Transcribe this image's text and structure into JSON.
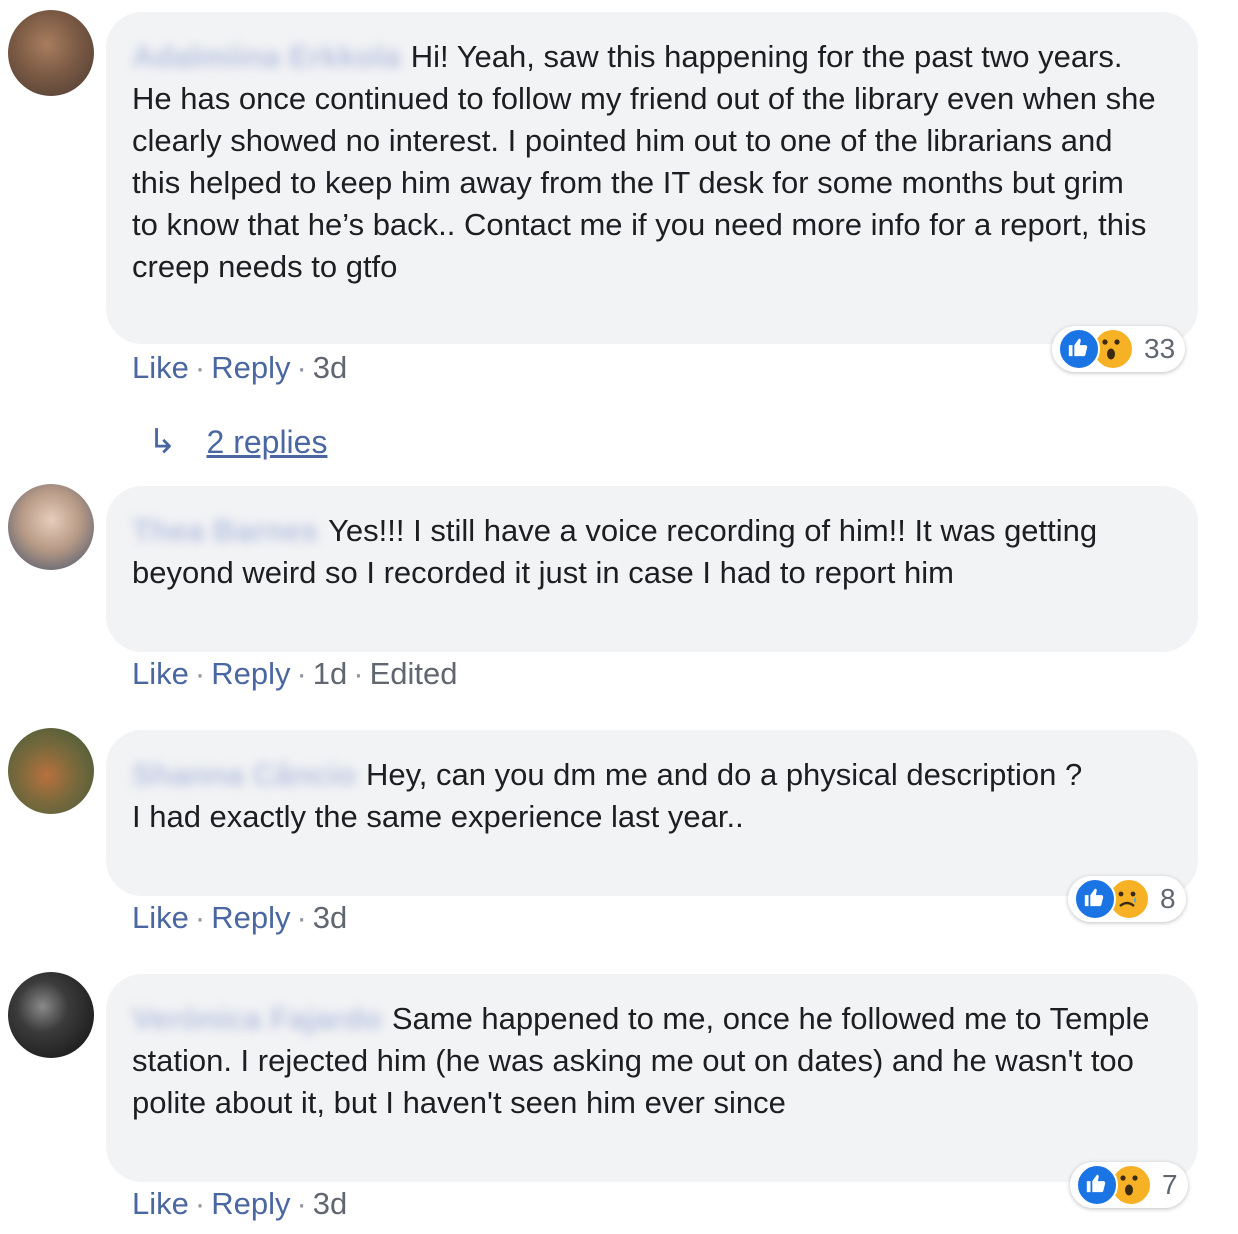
{
  "comments": [
    {
      "author": "Adalmiina Erkkola",
      "text": "Hi! Yeah, saw this happening for the past two years. He has once continued to follow my friend out of the library even when she clearly showed no interest. I pointed him out to one of the librarians and this helped to keep him away from the IT desk for some months but grim to know that he’s back.. Contact me if you need more info for a report, this creep needs to gtfo",
      "like_label": "Like",
      "reply_label": "Reply",
      "time": "3d",
      "reactions": {
        "icons": [
          "like-icon",
          "wow-icon"
        ],
        "count": "33"
      },
      "replies_label": "2 replies"
    },
    {
      "author": "Thea Barnes",
      "text": "Yes!!! I still have a voice recording of him!! It was getting beyond weird so I recorded it just in case I had to report him",
      "like_label": "Like",
      "reply_label": "Reply",
      "time": "1d",
      "edited": "Edited"
    },
    {
      "author": "Shanna Câncio",
      "text_lines": [
        "Hey, can you dm me and do a physical description ?",
        "I had exactly the same experience last year.."
      ],
      "like_label": "Like",
      "reply_label": "Reply",
      "time": "3d",
      "reactions": {
        "icons": [
          "like-icon",
          "sad-icon"
        ],
        "count": "8"
      }
    },
    {
      "author": "Verónica Fajardo",
      "text": "Same happened to me, once he followed me to Temple station. I rejected him (he was asking me out on dates) and he wasn't too polite about it, but I haven't seen him ever since",
      "like_label": "Like",
      "reply_label": "Reply",
      "time": "3d",
      "reactions": {
        "icons": [
          "like-icon",
          "wow-icon"
        ],
        "count": "7"
      }
    }
  ],
  "separator": "·",
  "colors": {
    "bubble": "#f2f3f5",
    "link": "#4b67a1",
    "like_blue": "#1b74e4",
    "emoji_yellow": "#f7b125"
  }
}
